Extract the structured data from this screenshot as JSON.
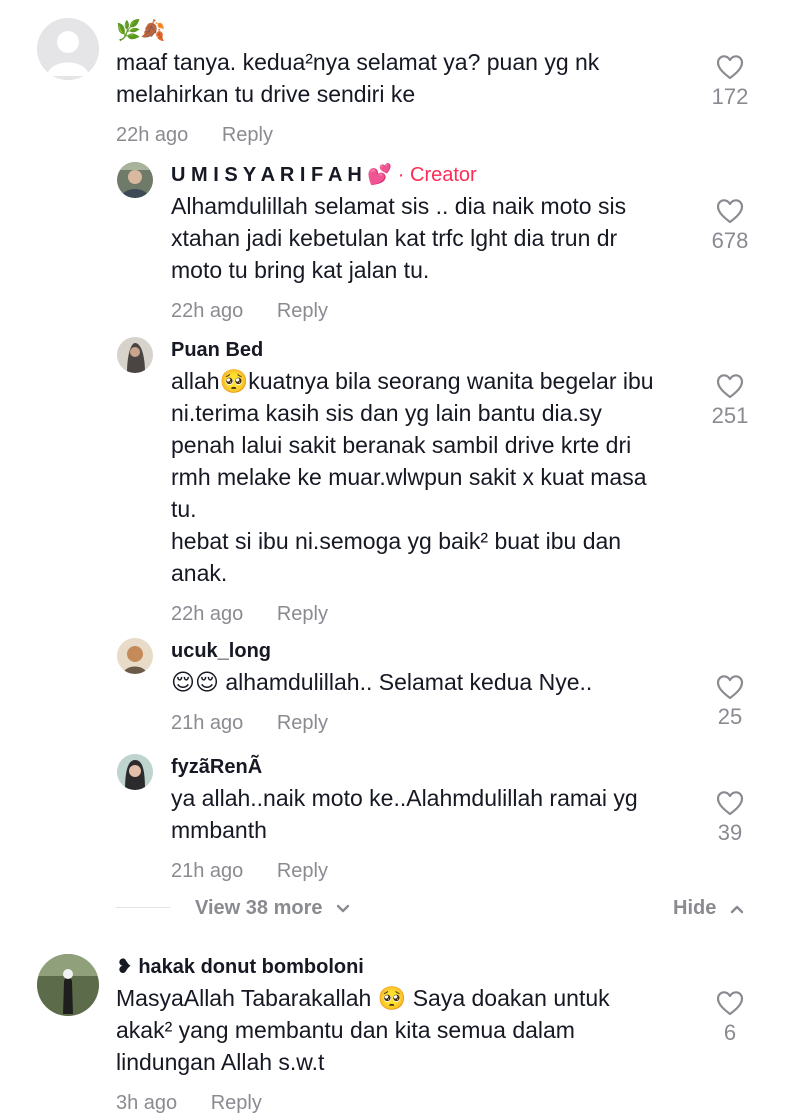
{
  "comments": [
    {
      "username": "🌿🍂",
      "lines": [
        "maaf tanya. kedua²nya selamat ya? puan yg nk",
        "melahirkan tu drive sendiri ke"
      ],
      "time": "22h ago",
      "reply": "Reply",
      "likes": "172"
    },
    {
      "username": "U M I S Y A R I F A H 💕",
      "badge": "· Creator",
      "lines": [
        "Alhamdulillah selamat sis .. dia naik moto sis",
        "xtahan jadi kebetulan kat trfc lght dia trun dr",
        "moto tu bring kat jalan tu."
      ],
      "time": "22h ago",
      "reply": "Reply",
      "likes": "678"
    },
    {
      "username": "Puan Bed",
      "lines": [
        "allah🥺kuatnya bila seorang wanita begelar ibu",
        "ni.terima kasih sis dan yg lain bantu dia.sy",
        "penah lalui sakit beranak sambil drive krte dri",
        "rmh melake ke muar.wlwpun sakit x kuat masa",
        "tu.",
        "hebat si ibu ni.semoga yg baik² buat ibu dan",
        "anak."
      ],
      "time": "22h ago",
      "reply": "Reply",
      "likes": "251"
    },
    {
      "username": "ucuk_long",
      "lines": [
        "😌😌 alhamdulillah.. Selamat kedua Nye.."
      ],
      "time": "21h ago",
      "reply": "Reply",
      "likes": "25"
    },
    {
      "username": "fyzãRenÃ",
      "lines": [
        "ya allah..naik moto ke..Alahmdulillah ramai yg",
        "mmbanth"
      ],
      "time": "21h ago",
      "reply": "Reply",
      "likes": "39"
    },
    {
      "username": "❥ hakak donut bomboloni",
      "lines": [
        "MasyaAllah Tabarakallah 🥺 Saya doakan untuk",
        "akak² yang membantu dan kita semua dalam",
        "lindungan Allah s.w.t"
      ],
      "time": "3h ago",
      "reply": "Reply",
      "likes": "6"
    }
  ],
  "thread": {
    "view_more": "View 38 more",
    "hide": "Hide"
  },
  "colors": {
    "text": "#161823",
    "secondary": "#8a8b91",
    "creator": "#fe2c55"
  },
  "icons": [
    "heart-outline-icon",
    "chevron-down-icon",
    "chevron-up-icon"
  ]
}
